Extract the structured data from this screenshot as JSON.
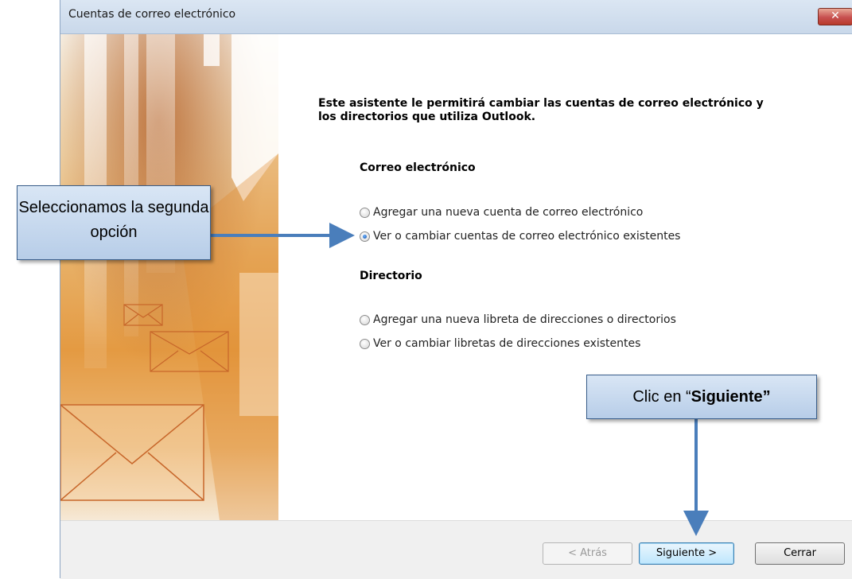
{
  "window": {
    "title": "Cuentas de correo electrónico",
    "close_glyph": "✕"
  },
  "content": {
    "intro": "Este asistente le permitirá cambiar las cuentas de correo electrónico y los directorios que utiliza Outlook.",
    "email_section": {
      "heading": "Correo electrónico",
      "options": [
        {
          "label": "Agregar una nueva cuenta de correo electrónico",
          "checked": false
        },
        {
          "label": "Ver o cambiar cuentas de correo electrónico existentes",
          "checked": true
        }
      ]
    },
    "directory_section": {
      "heading": "Directorio",
      "options": [
        {
          "label": "Agregar una nueva libreta de direcciones o directorios",
          "checked": false
        },
        {
          "label": "Ver o cambiar libretas de direcciones existentes",
          "checked": false
        }
      ]
    }
  },
  "footer": {
    "back_label": "< Atrás",
    "next_label": "Siguiente >",
    "close_label": "Cerrar"
  },
  "annotations": {
    "callout1_text": "Seleccionamos la segunda opción",
    "callout2_prefix": "Clic en “",
    "callout2_bold": "Siguiente”"
  },
  "colors": {
    "callout_fill": "#c6d9f1",
    "arrow": "#4a7ebb",
    "banner_orange": "#e49a42"
  },
  "icons": [
    "close-icon",
    "envelope-icon",
    "radio-icon",
    "arrow-icon"
  ]
}
